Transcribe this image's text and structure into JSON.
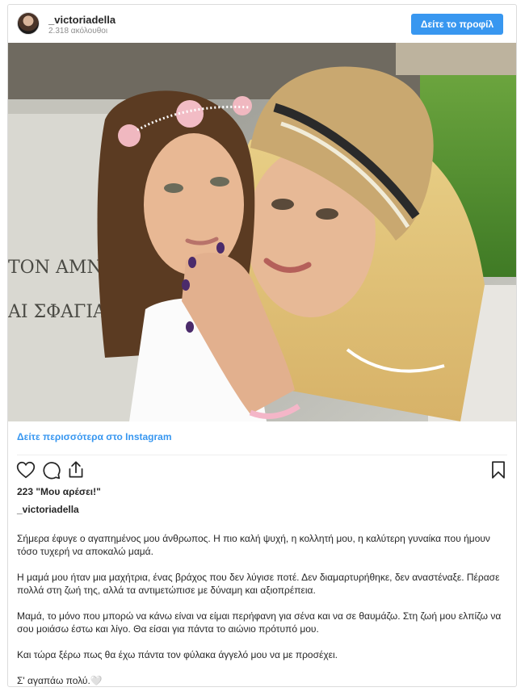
{
  "header": {
    "username": "_victoriadella",
    "followers": "2.318 ακόλουθοι",
    "view_profile_label": "Δείτε το προφίλ"
  },
  "post": {
    "image_alt": "Photo of a woman in a straw hat with a young girl wearing a flower crown",
    "more_on_instagram": "Δείτε περισσότερα στο Instagram",
    "likes": "223 \"Μου αρέσει!\"",
    "username": "_victoriadella",
    "caption": [
      "Σήμερα έφυγε ο αγαπημένος μου άνθρωπος. Η πιο καλή ψυχή, η κολλητή μου, η καλύτερη γυναίκα που ήμουν τόσο τυχερή να αποκαλώ μαμά.",
      "Η μαμά μου ήταν μια μαχήτρια, ένας βράχος που δεν λύγισε ποτέ. Δεν διαμαρτυρήθηκε, δεν αναστέναξε. Πέρασε πολλά στη ζωή της, αλλά τα αντιμετώπισε με δύναμη και αξιοπρέπεια.",
      "Μαμά, το μόνο που μπορώ να κάνω είναι να είμαι περήφανη για σένα και να σε θαυμάζω. Στη ζωή μου ελπίζω να σου μοιάσω έστω και λίγο. Θα είσαι για πάντα το αιώνιο πρότυπό μου.",
      "Και τώρα ξέρω πως θα έχω πάντα τον φύλακα άγγελό μου να με προσέχει.",
      "Σ' αγαπάω πολύ.🤍"
    ],
    "photo_inscription": [
      "ΤΟΝ ΑΜΝΟ",
      "ΑΙ ΣΦΑΓΙΑΣΘ"
    ]
  },
  "icons": {
    "like": "heart-icon",
    "comment": "comment-icon",
    "share": "share-icon",
    "save": "bookmark-icon"
  },
  "colors": {
    "accent": "#3897f0",
    "text": "#262626",
    "secondary": "#8e8e8e",
    "border": "#dbdbdb"
  }
}
